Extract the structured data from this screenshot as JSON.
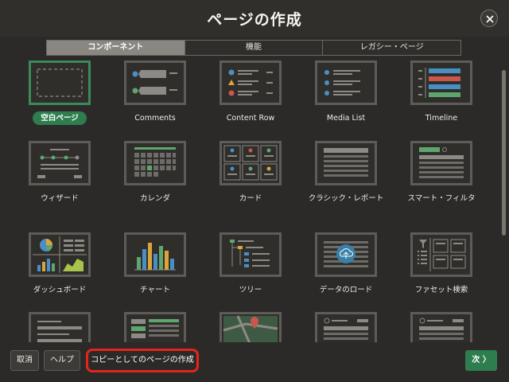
{
  "dialog": {
    "title": "ページの作成",
    "close_icon": "close-icon"
  },
  "tabs": [
    {
      "label": "コンポーネント",
      "active": true
    },
    {
      "label": "機能",
      "active": false
    },
    {
      "label": "レガシー・ページ",
      "active": false
    }
  ],
  "cards": [
    {
      "label": "空白ページ",
      "icon": "blank-page-icon",
      "selected": true
    },
    {
      "label": "Comments",
      "icon": "comments-icon"
    },
    {
      "label": "Content Row",
      "icon": "content-row-icon"
    },
    {
      "label": "Media List",
      "icon": "media-list-icon"
    },
    {
      "label": "Timeline",
      "icon": "timeline-icon"
    },
    {
      "label": "ウィザード",
      "icon": "wizard-icon"
    },
    {
      "label": "カレンダ",
      "icon": "calendar-icon"
    },
    {
      "label": "カード",
      "icon": "cards-icon"
    },
    {
      "label": "クラシック・レポート",
      "icon": "classic-report-icon"
    },
    {
      "label": "スマート・フィルタ",
      "icon": "smart-filter-icon"
    },
    {
      "label": "ダッシュボード",
      "icon": "dashboard-icon"
    },
    {
      "label": "チャート",
      "icon": "chart-icon"
    },
    {
      "label": "ツリー",
      "icon": "tree-icon"
    },
    {
      "label": "データのロード",
      "icon": "data-load-icon"
    },
    {
      "label": "ファセット検索",
      "icon": "faceted-search-icon"
    },
    {
      "label": "",
      "icon": "form-icon"
    },
    {
      "label": "",
      "icon": "master-detail-icon"
    },
    {
      "label": "",
      "icon": "map-icon"
    },
    {
      "label": "",
      "icon": "interactive-report-icon"
    },
    {
      "label": "",
      "icon": "interactive-grid-icon"
    }
  ],
  "footer": {
    "cancel_label": "取消",
    "help_label": "ヘルプ",
    "copy_label": "コピーとしてのページの作成",
    "next_label": "次 〉"
  },
  "colors": {
    "accent_green": "#2e7d4f",
    "highlight_red": "#e5251c",
    "background": "#2b2a28"
  }
}
